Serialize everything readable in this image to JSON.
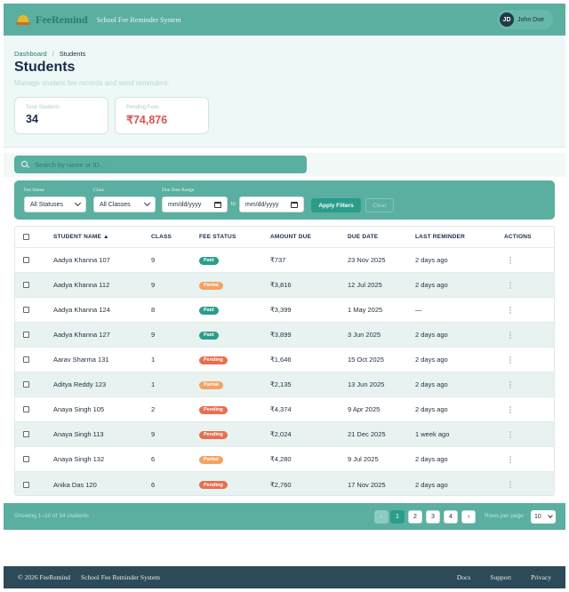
{
  "header": {
    "brand": "FeeRemind",
    "tagline": "School Fee Reminder System",
    "user": {
      "initials": "JD",
      "name": "John Doe"
    }
  },
  "breadcrumb": {
    "home": "Dashboard",
    "separator": "/",
    "current": "Students"
  },
  "page": {
    "title": "Students",
    "subtitle": "Manage student fee records and send reminders."
  },
  "stats": [
    {
      "label": "Total Students",
      "value": "34",
      "color": "#1a2b4a"
    },
    {
      "label": "Pending Fees",
      "value": "₹74,876",
      "color": "#d9534f"
    }
  ],
  "search": {
    "placeholder": "Search by name or ID..."
  },
  "filters": {
    "status_label": "Fee Status",
    "status_value": "All Statuses",
    "class_label": "Class",
    "class_value": "All Classes",
    "date_label": "Due Date Range",
    "date_from": "mm/dd/yyyy",
    "date_to_sep": "to",
    "date_to": "mm/dd/yyyy",
    "apply_label": "Apply Filters",
    "clear_label": "Clear"
  },
  "table": {
    "columns": [
      "STUDENT NAME ▲",
      "CLASS",
      "FEE STATUS",
      "AMOUNT DUE",
      "DUE DATE",
      "LAST REMINDER",
      "ACTIONS"
    ],
    "rows": [
      {
        "name": "Aadya Khanna 107",
        "class": "9",
        "status": "Paid",
        "amount": "₹737",
        "due": "23 Nov 2025",
        "reminder": "2 days ago"
      },
      {
        "name": "Aadya Khanna 112",
        "class": "9",
        "status": "Partial",
        "amount": "₹3,816",
        "due": "12 Jul 2025",
        "reminder": "2 days ago"
      },
      {
        "name": "Aadya Khanna 124",
        "class": "8",
        "status": "Paid",
        "amount": "₹3,399",
        "due": "1 May 2025",
        "reminder": "—"
      },
      {
        "name": "Aadya Khanna 127",
        "class": "9",
        "status": "Paid",
        "amount": "₹3,899",
        "due": "3 Jun 2025",
        "reminder": "2 days ago"
      },
      {
        "name": "Aarav Sharma 131",
        "class": "1",
        "status": "Pending",
        "amount": "₹1,646",
        "due": "15 Oct 2025",
        "reminder": "2 days ago"
      },
      {
        "name": "Aditya Reddy 123",
        "class": "1",
        "status": "Partial",
        "amount": "₹2,135",
        "due": "13 Jun 2025",
        "reminder": "2 days ago"
      },
      {
        "name": "Anaya Singh 105",
        "class": "2",
        "status": "Pending",
        "amount": "₹4,374",
        "due": "9 Apr 2025",
        "reminder": "2 days ago"
      },
      {
        "name": "Anaya Singh 113",
        "class": "9",
        "status": "Pending",
        "amount": "₹2,024",
        "due": "21 Dec 2025",
        "reminder": "1 week ago"
      },
      {
        "name": "Anaya Singh 132",
        "class": "6",
        "status": "Partial",
        "amount": "₹4,280",
        "due": "9 Jul 2025",
        "reminder": "2 days ago"
      },
      {
        "name": "Anika Das 120",
        "class": "6",
        "status": "Pending",
        "amount": "₹2,760",
        "due": "17 Nov 2025",
        "reminder": "2 days ago"
      }
    ]
  },
  "status_colors": {
    "Paid": "#2a9d8a",
    "Partial": "#f4a261",
    "Pending": "#e76f51"
  },
  "pagination": {
    "summary": "Showing 1–10 of 34 students",
    "prev": "‹",
    "pages": [
      "1",
      "2",
      "3",
      "4"
    ],
    "next": "›",
    "rows_label": "Rows per page:",
    "rows_value": "10"
  },
  "footer": {
    "copyright": "© 2026 FeeRemind",
    "tagline": "School Fee Reminder System",
    "links": [
      "Docs",
      "Support",
      "Privacy"
    ]
  }
}
